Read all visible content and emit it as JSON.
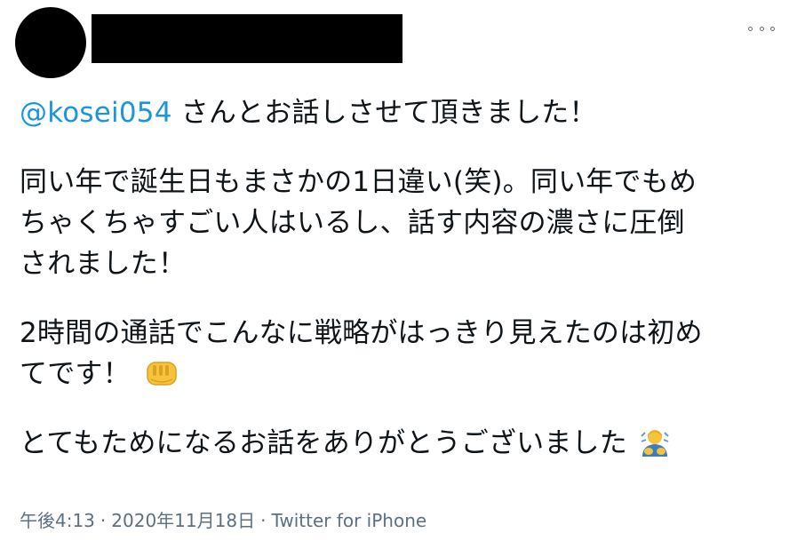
{
  "tweet": {
    "mention": "@kosei054",
    "lines": [
      " さんとお話しさせて頂きました！",
      "同い年で誕生日もまさかの1日違い(笑)。同い年でもめ",
      "ちゃくちゃすごい人はいるし、話す内容の濃さに圧倒",
      "されました！",
      "2時間の通話でこんなに戦略がはっきり見えたのは初め",
      "てです！",
      "とてもためになるお話をありがとうございました"
    ],
    "emojis": [
      "fist-bump-emoji",
      "bowing-person-emoji"
    ]
  },
  "meta": {
    "time": "午後4:13",
    "sep": "·",
    "date": "2020年11月18日",
    "source": "Twitter for iPhone"
  },
  "colors": {
    "mention": "#1b95e0",
    "text": "#0f1419",
    "meta": "#5b7083"
  }
}
